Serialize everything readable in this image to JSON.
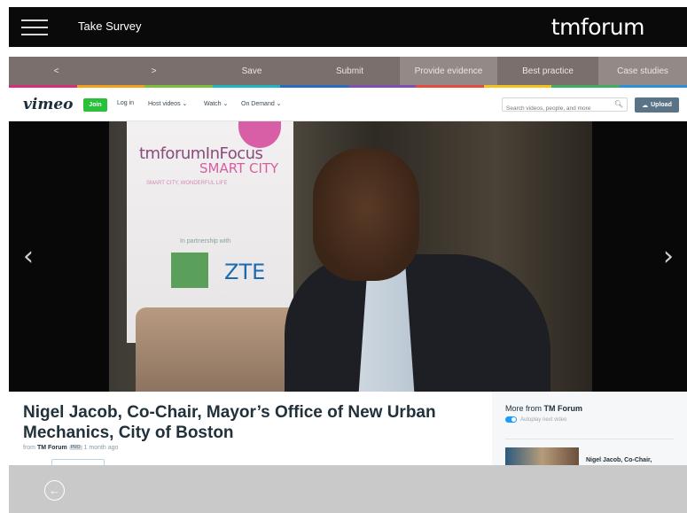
{
  "app": {
    "title": "Take Survey",
    "brand": "tmforum"
  },
  "nav": {
    "items": [
      {
        "label": "<"
      },
      {
        "label": ">"
      },
      {
        "label": "Save"
      },
      {
        "label": "Submit"
      },
      {
        "label": "Provide evidence"
      },
      {
        "label": "Best practice"
      },
      {
        "label": "Case studies"
      }
    ]
  },
  "stripe_colors": [
    "#d62f7a",
    "#f2a11d",
    "#7fbf3f",
    "#1fb5c6",
    "#2a6bc2",
    "#7e4fb5",
    "#e64b3b",
    "#f4c21c",
    "#3fae62",
    "#2d8fd8"
  ],
  "vimeo": {
    "logo": "vimeo",
    "join": "Join",
    "login": "Log in",
    "host_videos": "Host videos ⌄",
    "watch": "Watch ⌄",
    "on_demand": "On Demand ⌄",
    "search_placeholder": "Search videos, people, and more",
    "upload": "Upload"
  },
  "player": {
    "banner_title": "tmforumInFocus",
    "banner_subtitle": "SMART CITY",
    "banner_tagline": "SMART CITY, WONDERFUL LIFE",
    "banner_partner": "In partnership with",
    "banner_sponsor": "ZTE",
    "prev_arrow": "‹",
    "next_arrow": "›"
  },
  "video": {
    "title": "Nigel Jacob, Co-Chair, Mayor’s Office of New Urban Mechanics, City of Boston",
    "from_label": "from",
    "channel": "TM Forum",
    "pro_badge": "PRO",
    "age": "1 month ago"
  },
  "sidebar": {
    "more_from_label": "More from",
    "more_from_channel": "TM Forum",
    "autoplay_label": "Autoplay next video",
    "next_title": "Nigel Jacob, Co-Chair,"
  },
  "bottom": {
    "back_icon": "←"
  }
}
